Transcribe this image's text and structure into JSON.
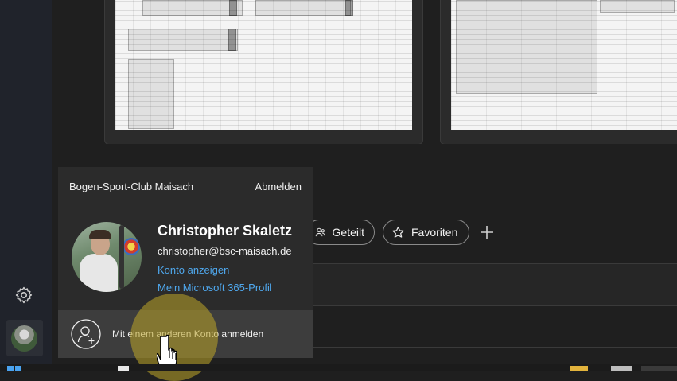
{
  "account_flyout": {
    "org_name": "Bogen-Sport-Club Maisach",
    "sign_out_label": "Abmelden",
    "user_name": "Christopher Skaletz",
    "user_email": "christopher@bsc-maisach.de",
    "view_account_link": "Konto anzeigen",
    "m365_profile_link": "Mein Microsoft 365-Profil",
    "other_account_label": "Mit einem anderen Konto anmelden"
  },
  "filters": {
    "shared_label": "Geteilt",
    "favorites_label": "Favoriten"
  },
  "icons": {
    "settings": "gear-icon",
    "avatar": "user-avatar",
    "shared": "people-icon",
    "favorites": "star-icon",
    "add": "plus-icon",
    "add_account": "person-add-icon"
  },
  "colors": {
    "link": "#4fa8ee",
    "flyout_bg": "#2b2b2b",
    "highlight": "#bea528"
  }
}
